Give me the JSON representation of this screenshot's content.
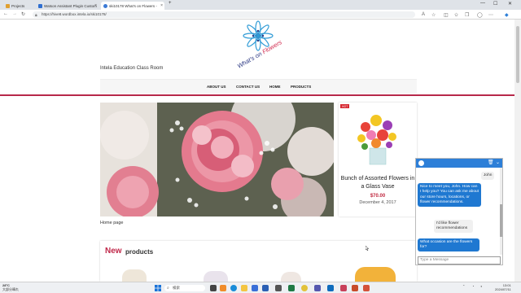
{
  "browser": {
    "tabs": [
      {
        "label": "Projects"
      },
      {
        "label": "Watson Assistant Plugin Custom"
      },
      {
        "label": "ski10178 What's on Flowers -"
      }
    ],
    "url": "https://hive8.wordbox.intela.io/ski10178/"
  },
  "site": {
    "logo_text_a": "What's on ",
    "logo_text_b": "Flowers",
    "description": "Intela Education Class Room",
    "menu": [
      "ABOUT US",
      "CONTACT US",
      "HOME",
      "PRODUCTS"
    ]
  },
  "hero": {
    "caption": "Home page"
  },
  "featured": {
    "badge": "HOT",
    "title": "Bunch of Assorted Flowers in a Glass Vase",
    "price": "$70.00",
    "date": "December 4, 2017"
  },
  "new_products": {
    "label_new": "New",
    "label_products": "products"
  },
  "chat": {
    "messages": [
      {
        "from": "user",
        "text": "John"
      },
      {
        "from": "bot",
        "text": "Nice to meet you, John. How can I help you? You can ask me about our store hours, locations, or flower recommendations."
      },
      {
        "from": "user",
        "text": "I'd like flower recommendations"
      },
      {
        "from": "bot",
        "text": "What occasion are the flowers for?"
      }
    ],
    "input_placeholder": "Type a Message"
  },
  "taskbar": {
    "weather_temp": "28°C",
    "weather_desc": "大部分晴れ",
    "search_label": "検索",
    "time": "13:01",
    "date": "2024/07/11"
  },
  "colors": {
    "accent": "#b7284a",
    "chat_blue": "#1f78d1"
  }
}
